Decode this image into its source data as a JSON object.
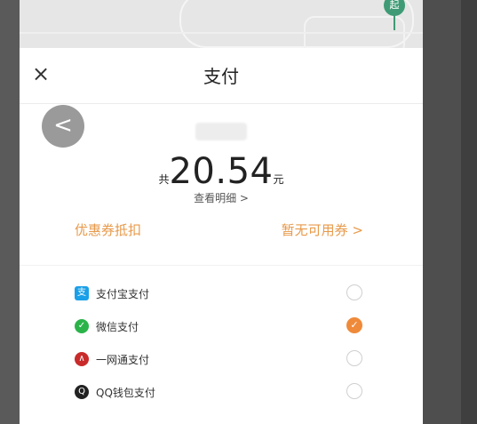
{
  "map": {
    "pin_label": "起"
  },
  "header": {
    "title": "支付",
    "close_icon": "×"
  },
  "nav": {
    "back_icon": "<"
  },
  "payment": {
    "prefix": "共",
    "amount": "20.54",
    "suffix": "元",
    "detail_link": "查看明细 >"
  },
  "coupon": {
    "label": "优惠券抵扣",
    "value": "暂无可用券 >"
  },
  "methods": [
    {
      "name": "alipay",
      "label": "支付宝支付",
      "icon": "支",
      "icon_color": "#1aa0e8",
      "checked": false
    },
    {
      "name": "wechat",
      "label": "微信支付",
      "icon": "✓",
      "icon_color": "#2bb34a",
      "checked": true
    },
    {
      "name": "yiwangtong",
      "label": "一网通支付",
      "icon": "∧",
      "icon_color": "#c92b2b",
      "checked": false
    },
    {
      "name": "qq-wallet",
      "label": "QQ钱包支付",
      "icon": "Q",
      "icon_color": "#222222",
      "checked": false
    }
  ],
  "colors": {
    "accent": "#ef8a3a",
    "coupon_text": "#e79a4b"
  }
}
